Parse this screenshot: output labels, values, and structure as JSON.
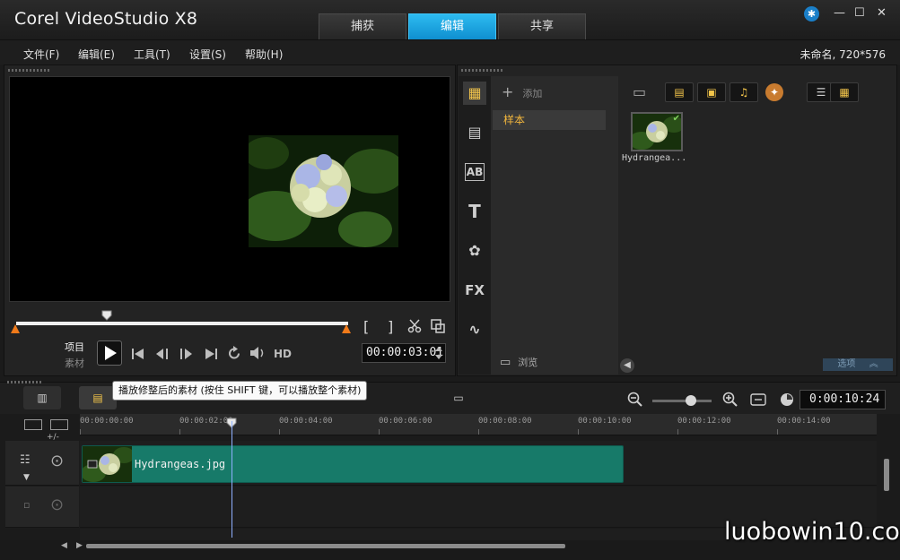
{
  "window": {
    "title": "Corel VideoStudio X8",
    "project_info": "未命名, 720*576",
    "help_badge": "✱",
    "minimize": "—",
    "maximize": "☐",
    "close": "✕"
  },
  "tabs": [
    {
      "label": "捕获",
      "active": false
    },
    {
      "label": "编辑",
      "active": true
    },
    {
      "label": "共享",
      "active": false
    }
  ],
  "menu": [
    "文件(F)",
    "编辑(E)",
    "工具(T)",
    "设置(S)",
    "帮助(H)"
  ],
  "player": {
    "mode_project": "项目",
    "mode_clip": "素材",
    "mark_in": "[",
    "mark_out": "]",
    "hd_label": "HD",
    "timecode": "00:00:03:01",
    "tooltip": "播放修整后的素材 (按住 SHIFT 键，可以播放整个素材)",
    "scrub_position": 0.28
  },
  "library": {
    "add_label": "添加",
    "folder": "样本",
    "browse_label": "浏览",
    "options_label": "选项",
    "items": [
      {
        "name": "Hydrangea..."
      }
    ],
    "side_icons": [
      "media-icon",
      "instant-project-icon",
      "transition-icon",
      "title-icon",
      "graphic-icon",
      "filter-icon",
      "path-icon"
    ]
  },
  "timeline": {
    "duration": "0:00:10:24",
    "ruler": [
      "00:00:00:00",
      "00:00:02:00",
      "00:00:04:00",
      "00:00:06:00",
      "00:00:08:00",
      "00:00:10:00",
      "00:00:12:00",
      "00:00:14:00"
    ],
    "clip_label": "Hydrangeas.jpg",
    "add_remove": "+/-"
  },
  "watermark": "luobowin10.com",
  "colors": {
    "accent": "#1ea6e6",
    "folder_text": "#f3b73d",
    "clip": "#177a69"
  }
}
